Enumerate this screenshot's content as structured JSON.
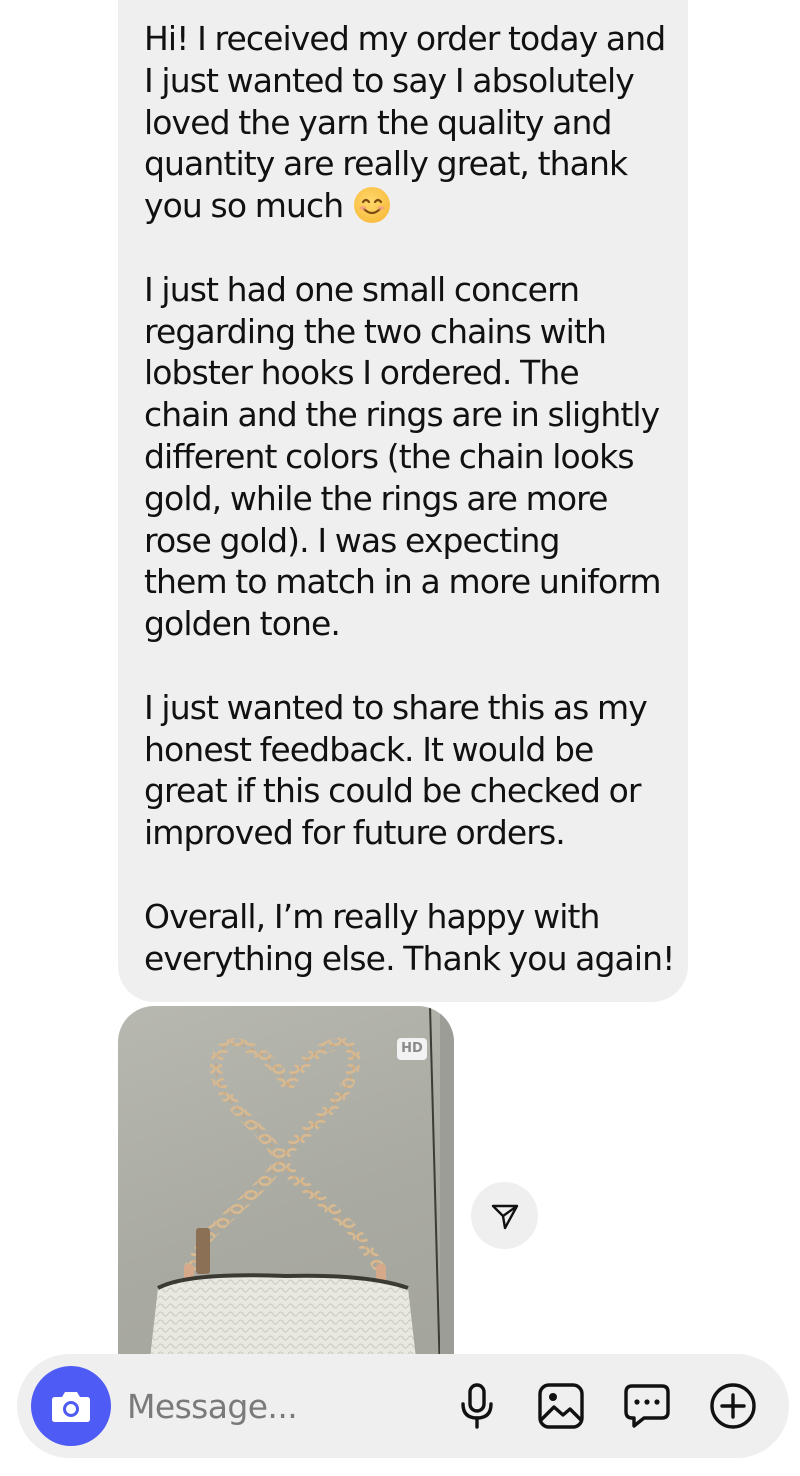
{
  "message": {
    "paragraphs": [
      "Hi! I received my order today and\nI just wanted to say I absolutely\nloved the yarn the quality and\nquantity are really great, thank\nyou so much",
      "I just had one small concern\nregarding the two chains with\nlobster hooks I ordered. The\nchain and the rings are in slightly\ndifferent colors (the chain looks\ngold, while the rings are more\nrose gold). I was expecting\nthem to match in a more uniform\ngolden tone.",
      "I just wanted to share this as my\nhonest feedback. It would be\ngreat if this could be checked or\nimproved for future orders.",
      "Overall, I’m really happy with\neverything else. Thank you again!"
    ],
    "emoji": "smiling-face-emoji"
  },
  "photo": {
    "badge": "HD",
    "subject": "gold-chain-heart-on-white-crochet-bag"
  },
  "composer": {
    "placeholder": "Message...",
    "icons": [
      "camera-icon",
      "microphone-icon",
      "gallery-icon",
      "sticker-chat-icon",
      "plus-icon"
    ],
    "camera_color": "#4f5bf5"
  },
  "colors": {
    "bubble": "#efefef",
    "text": "#111111"
  }
}
